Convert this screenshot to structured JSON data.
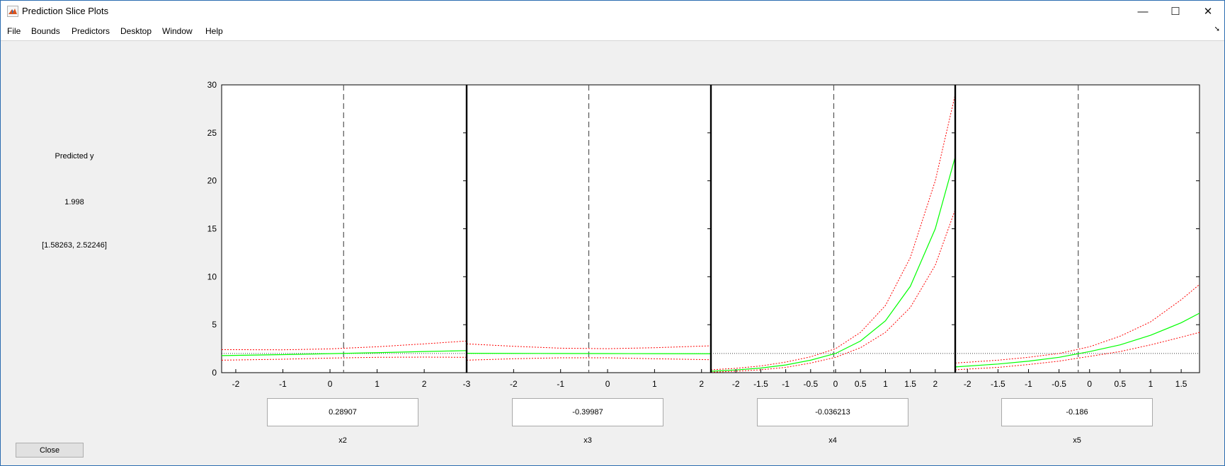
{
  "window": {
    "title": "Prediction Slice Plots",
    "minimize_glyph": "—",
    "maximize_glyph": "☐",
    "close_glyph": "✕",
    "icon": "matlab-icon"
  },
  "menu": [
    "File",
    "Bounds",
    "Predictors",
    "Desktop",
    "Window",
    "Help"
  ],
  "side_panel": {
    "label": "Predicted y",
    "value": "1.998",
    "interval": "[1.58263, 2.52246]"
  },
  "close_button": "Close",
  "colors": {
    "fit": "#00ff00",
    "bounds": "#ff0000",
    "reference_line": "#000000",
    "current_value_line": "#555555"
  },
  "y_axis": {
    "ylim": [
      0,
      30
    ],
    "ticks": [
      "0",
      "5",
      "10",
      "15",
      "20",
      "25",
      "30"
    ]
  },
  "predicted_y_reference": 1.998,
  "chart_data": [
    {
      "type": "line",
      "predictor": "x2",
      "current_value": "0.28907",
      "current": 0.28907,
      "xlim": [
        -2.3,
        2.9
      ],
      "ylim": [
        0,
        30
      ],
      "xticks": [
        "-2",
        "-1",
        "0",
        "1",
        "2",
        "-3"
      ],
      "xtick_values": [
        -2,
        -1,
        0,
        1,
        2,
        2.9
      ],
      "series": [
        {
          "role": "fit",
          "x": [
            -2.3,
            -1,
            0,
            1,
            2,
            2.9
          ],
          "y": [
            1.78,
            1.88,
            1.98,
            2.08,
            2.2,
            2.3
          ]
        },
        {
          "role": "upper",
          "x": [
            -2.3,
            -1,
            0,
            1,
            2,
            2.9
          ],
          "y": [
            2.4,
            2.38,
            2.48,
            2.7,
            3.0,
            3.3
          ]
        },
        {
          "role": "lower",
          "x": [
            -2.3,
            -1,
            0,
            1,
            2,
            2.9
          ],
          "y": [
            1.3,
            1.4,
            1.52,
            1.6,
            1.62,
            1.6
          ]
        }
      ]
    },
    {
      "type": "line",
      "predictor": "x3",
      "current_value": "-0.39987",
      "current": -0.39987,
      "xlim": [
        -3,
        2.2
      ],
      "ylim": [
        0,
        30
      ],
      "xticks": [
        "-2",
        "-1",
        "0",
        "1",
        "2"
      ],
      "xtick_values": [
        -2,
        -1,
        0,
        1,
        2
      ],
      "series": [
        {
          "role": "fit",
          "x": [
            -3,
            -2,
            -1,
            0,
            1,
            2.2
          ],
          "y": [
            2.02,
            2.01,
            2.0,
            1.99,
            1.98,
            1.97
          ]
        },
        {
          "role": "upper",
          "x": [
            -3,
            -2,
            -1,
            0,
            1,
            2.2
          ],
          "y": [
            3.0,
            2.75,
            2.55,
            2.5,
            2.6,
            2.8
          ]
        },
        {
          "role": "lower",
          "x": [
            -3,
            -2,
            -1,
            0,
            1,
            2.2
          ],
          "y": [
            1.3,
            1.45,
            1.55,
            1.55,
            1.45,
            1.35
          ]
        }
      ]
    },
    {
      "type": "line",
      "predictor": "x4",
      "current_value": "-0.036213",
      "current": -0.036213,
      "xlim": [
        -2.5,
        2.4
      ],
      "ylim": [
        0,
        30
      ],
      "xticks": [
        "-2",
        "-1.5",
        "-1",
        "-0.5",
        "0",
        "0.5",
        "1",
        "1.5",
        "2"
      ],
      "xtick_values": [
        -2,
        -1.5,
        -1,
        -0.5,
        0,
        0.5,
        1,
        1.5,
        2
      ],
      "series": [
        {
          "role": "fit",
          "x": [
            -2.5,
            -2,
            -1.5,
            -1,
            -0.5,
            0,
            0.5,
            1,
            1.5,
            2,
            2.4
          ],
          "y": [
            0.15,
            0.28,
            0.48,
            0.8,
            1.3,
            2.0,
            3.3,
            5.4,
            9.0,
            15.0,
            22.5
          ]
        },
        {
          "role": "upper",
          "x": [
            -2.5,
            -2,
            -1.5,
            -1,
            -0.5,
            0,
            0.5,
            1,
            1.5,
            2,
            2.4
          ],
          "y": [
            0.3,
            0.45,
            0.7,
            1.1,
            1.65,
            2.5,
            4.2,
            7.0,
            12.0,
            20.0,
            29.0
          ]
        },
        {
          "role": "lower",
          "x": [
            -2.5,
            -2,
            -1.5,
            -1,
            -0.5,
            0,
            0.5,
            1,
            1.5,
            2,
            2.4
          ],
          "y": [
            0.05,
            0.15,
            0.3,
            0.55,
            1.0,
            1.6,
            2.6,
            4.2,
            6.8,
            11.2,
            17.0
          ]
        }
      ]
    },
    {
      "type": "line",
      "predictor": "x5",
      "current_value": "-0.186",
      "current": -0.186,
      "xlim": [
        -2.2,
        1.8
      ],
      "ylim": [
        0,
        30
      ],
      "xticks": [
        "-2",
        "-1.5",
        "-1",
        "-0.5",
        "0",
        "0.5",
        "1",
        "1.5"
      ],
      "xtick_values": [
        -2,
        -1.5,
        -1,
        -0.5,
        0,
        0.5,
        1,
        1.5
      ],
      "series": [
        {
          "role": "fit",
          "x": [
            -2.2,
            -1.5,
            -1,
            -0.5,
            0,
            0.5,
            1,
            1.5,
            1.8
          ],
          "y": [
            0.6,
            0.9,
            1.2,
            1.6,
            2.2,
            2.9,
            3.9,
            5.2,
            6.2
          ]
        },
        {
          "role": "upper",
          "x": [
            -2.2,
            -1.5,
            -1,
            -0.5,
            0,
            0.5,
            1,
            1.5,
            1.8
          ],
          "y": [
            1.0,
            1.3,
            1.6,
            2.0,
            2.7,
            3.8,
            5.3,
            7.6,
            9.2
          ]
        },
        {
          "role": "lower",
          "x": [
            -2.2,
            -1.5,
            -1,
            -0.5,
            0,
            0.5,
            1,
            1.5,
            1.8
          ],
          "y": [
            0.3,
            0.55,
            0.85,
            1.2,
            1.7,
            2.2,
            2.9,
            3.7,
            4.2
          ]
        }
      ]
    }
  ]
}
